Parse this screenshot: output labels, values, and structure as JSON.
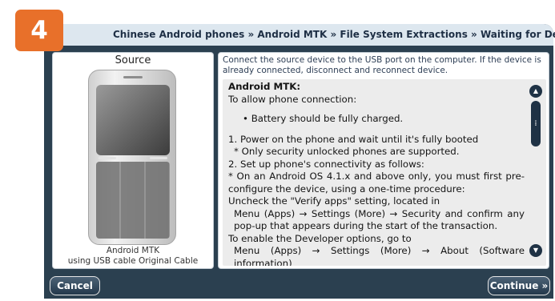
{
  "step": {
    "number": "4",
    "color": "#e8702a"
  },
  "header": {
    "breadcrumb": "Chinese Android phones » Android MTK » File System Extractions » Waiting for Device"
  },
  "source": {
    "title": "Source",
    "device_icon": "mobile-phone-icon",
    "device_name": "Android MTK",
    "cable_description": "using USB cable Original Cable"
  },
  "instructions": {
    "intro": "Connect the source device to the USB port on the computer. If the device is already connected, disconnect and reconnect device.",
    "heading": "Android MTK:",
    "lines": [
      "To allow phone connection:",
      "•  Battery should be fully charged.",
      "1. Power on the phone and wait until it's fully booted",
      " * Only security unlocked phones are supported.",
      "2. Set up phone's connectivity as follows:",
      "* On an Android OS 4.1.x and above only, you must first pre-configure the device, using a one-time procedure:",
      "Uncheck the \"Verify apps\" setting, located in",
      " Menu (Apps) → Settings (More) → Security and confirm any pop-up that appears during the start of the transaction.",
      "To enable the Developer options, go to",
      " Menu (Apps) → Settings (More) → About (Software information)"
    ],
    "scrollbar": {
      "up_icon": "chevron-up-icon",
      "down_icon": "chevron-down-icon",
      "thumb_icon": "grip-icon"
    }
  },
  "buttons": {
    "cancel": "Cancel",
    "continue": "Continue »"
  },
  "colors": {
    "window_frame": "#2b4050",
    "title_bar": "#dde7ef",
    "scrollbar": "#1f3245",
    "instruction_background": "#ececec"
  }
}
